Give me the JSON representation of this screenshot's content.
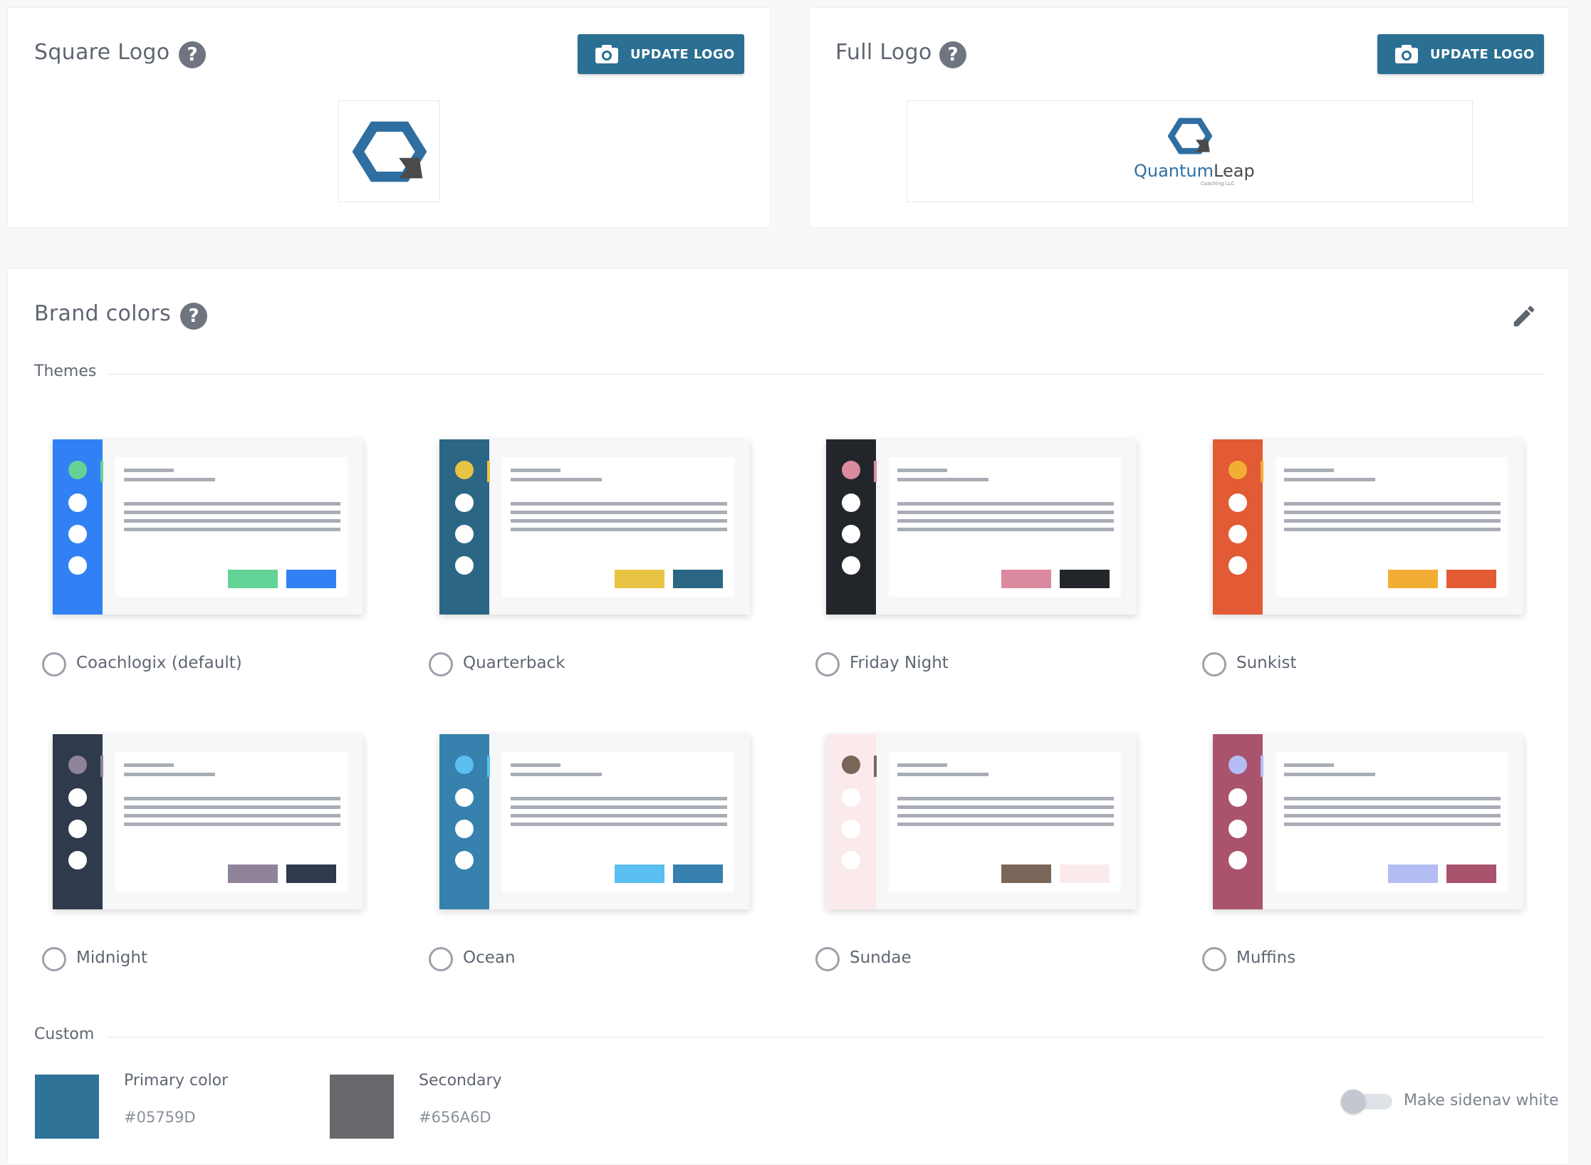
{
  "square_logo": {
    "title": "Square Logo",
    "button_label": "UPDATE LOGO"
  },
  "full_logo": {
    "title": "Full Logo",
    "button_label": "UPDATE LOGO",
    "logo_text_quantum": "Quantum",
    "logo_text_leap": "Leap",
    "logo_subtext": "Coaching LLC"
  },
  "brand_colors": {
    "title": "Brand colors",
    "themes_label": "Themes",
    "custom_label": "Custom",
    "themes": [
      {
        "name": "Coachlogix (default)",
        "sidebar": "#3181f5",
        "accent": "#63d395",
        "tick": "#63d395",
        "dot": "#63d395",
        "btn1": "#63d395",
        "btn2": "#3181f5"
      },
      {
        "name": "Quarterback",
        "sidebar": "#2b6784",
        "accent": "#e9c444",
        "tick": "#e9c444",
        "dot": "#e9c444",
        "btn1": "#e9c444",
        "btn2": "#2b6784"
      },
      {
        "name": "Friday Night",
        "sidebar": "#22262b",
        "accent": "#dc8aa0",
        "tick": "#dc8aa0",
        "dot": "#dc8aa0",
        "btn1": "#dc8aa0",
        "btn2": "#22262b"
      },
      {
        "name": "Sunkist",
        "sidebar": "#e25b34",
        "accent": "#f2ae34",
        "tick": "#f2ae34",
        "dot": "#f2ae34",
        "btn1": "#f2ae34",
        "btn2": "#e25b34"
      },
      {
        "name": "Midnight",
        "sidebar": "#2f3a4c",
        "accent": "#8e8398",
        "tick": "#8e8398",
        "dot": "#8e8398",
        "btn1": "#8e8398",
        "btn2": "#2f3a4c"
      },
      {
        "name": "Ocean",
        "sidebar": "#3681ad",
        "accent": "#5bbff2",
        "tick": "#5bbff2",
        "dot": "#5bbff2",
        "btn1": "#5bbff2",
        "btn2": "#3681ad"
      },
      {
        "name": "Sundae",
        "sidebar": "#fbeaec",
        "accent": "#7a6659",
        "tick": "#7a6659",
        "dot": "#7a6659",
        "btn1": "#7a6659",
        "btn2": "#fbeaec"
      },
      {
        "name": "Muffins",
        "sidebar": "#a9536c",
        "accent": "#b4bdf3",
        "tick": "#b4bdf3",
        "dot": "#b4bdf3",
        "btn1": "#b4bdf3",
        "btn2": "#a9536c"
      }
    ],
    "primary": {
      "label": "Primary color",
      "hex": "#05759D",
      "swatch": "#2f7399"
    },
    "secondary": {
      "label": "Secondary",
      "hex": "#656A6D",
      "swatch": "#67696c"
    },
    "sidenav_toggle_label": "Make sidenav white",
    "sidenav_white_on": false
  }
}
